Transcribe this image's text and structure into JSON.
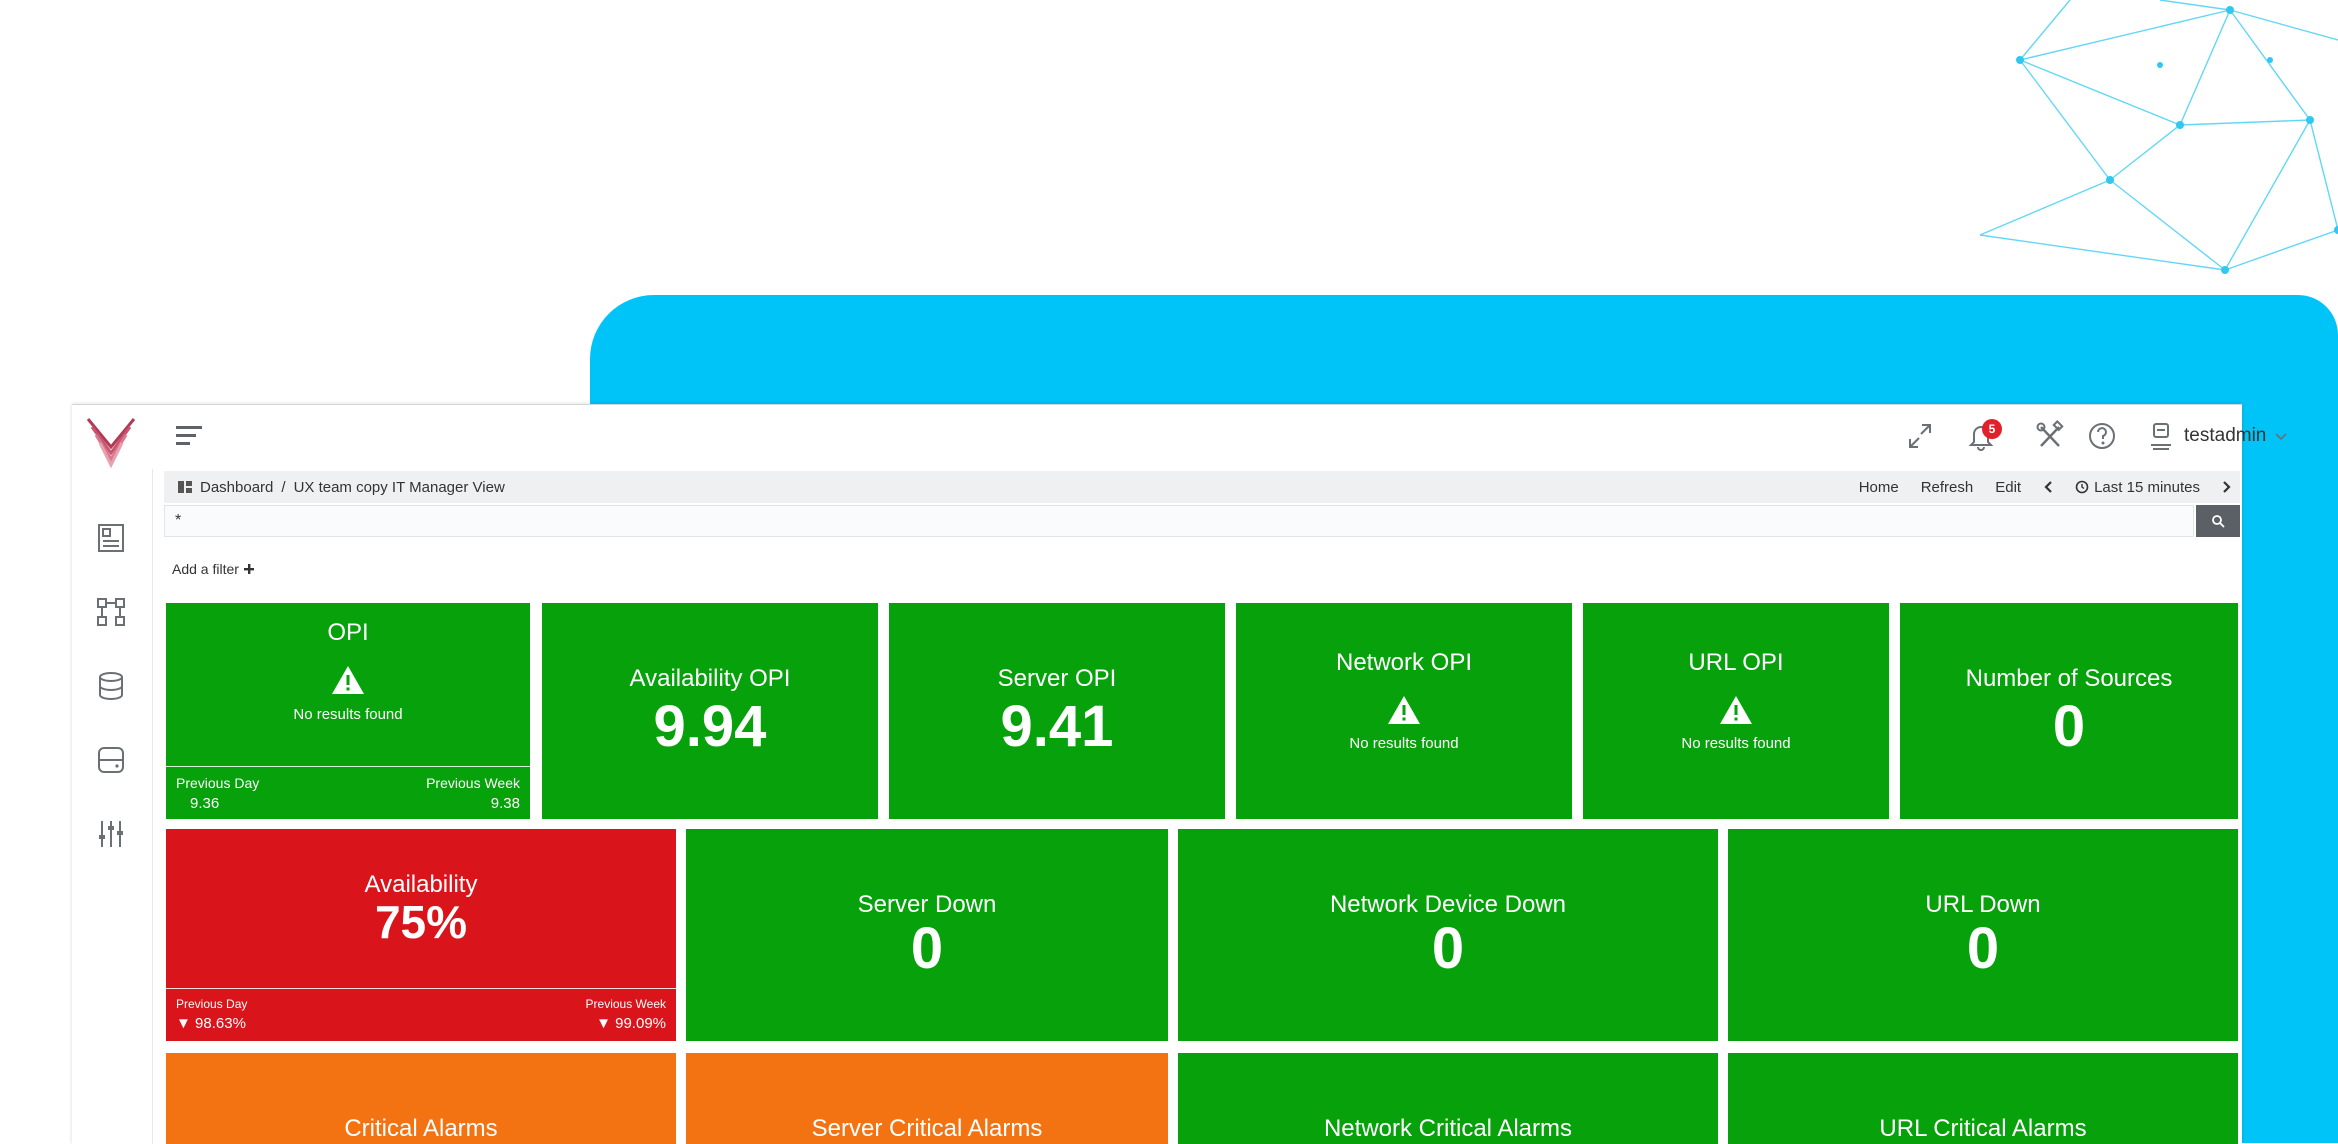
{
  "header": {
    "user_name": "testadmin",
    "notification_count": "5",
    "icons": [
      "expand-icon",
      "bell-icon",
      "tools-icon",
      "help-icon",
      "user-icon"
    ]
  },
  "breadcrumb": {
    "root": "Dashboard",
    "separator": "/",
    "current": "UX team copy IT Manager View"
  },
  "crumb_actions": {
    "home": "Home",
    "refresh": "Refresh",
    "edit": "Edit",
    "time_range": "Last 15 minutes"
  },
  "query": {
    "value": "*"
  },
  "add_filter_label": "Add a filter",
  "tiles": {
    "opi": {
      "title": "OPI",
      "no_results": "No results found",
      "prev_day_label": "Previous Day",
      "prev_day_value": "9.36",
      "prev_week_label": "Previous Week",
      "prev_week_value": "9.38"
    },
    "availability_opi": {
      "title": "Availability OPI",
      "value": "9.94"
    },
    "server_opi": {
      "title": "Server OPI",
      "value": "9.41"
    },
    "network_opi": {
      "title": "Network OPI",
      "no_results": "No results found"
    },
    "url_opi": {
      "title": "URL OPI",
      "no_results": "No results found"
    },
    "num_sources": {
      "title": "Number of Sources",
      "value": "0"
    },
    "availability": {
      "title": "Availability",
      "value": "75%",
      "prev_day_label": "Previous Day",
      "prev_day_value": "98.63%",
      "prev_week_label": "Previous Week",
      "prev_week_value": "99.09%"
    },
    "server_down": {
      "title": "Server Down",
      "value": "0"
    },
    "network_down": {
      "title": "Network Device Down",
      "value": "0"
    },
    "url_down": {
      "title": "URL Down",
      "value": "0"
    },
    "critical_alarms": {
      "title": "Critical Alarms"
    },
    "server_critical": {
      "title": "Server Critical Alarms"
    },
    "network_critical": {
      "title": "Network Critical Alarms"
    },
    "url_critical": {
      "title": "URL Critical Alarms"
    }
  },
  "colors": {
    "ok": "#06a10b",
    "critical": "#d9141b",
    "warning": "#f37312",
    "backdrop": "#00c4f7"
  }
}
